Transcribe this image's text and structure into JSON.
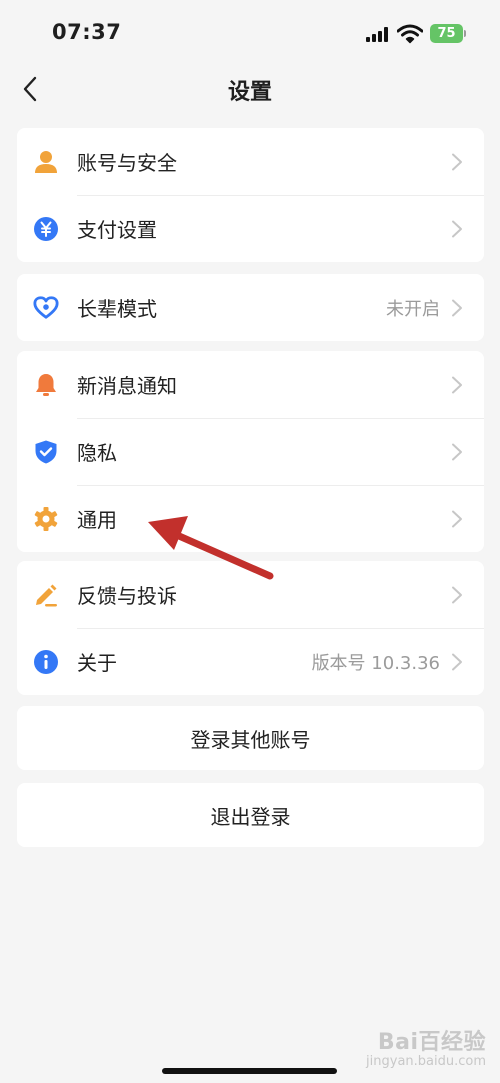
{
  "status_bar": {
    "time": "07:37",
    "battery": "75"
  },
  "nav": {
    "title": "设置"
  },
  "groups": [
    [
      {
        "label": "账号与安全",
        "icon": "person-icon",
        "color": "#f1a33a"
      },
      {
        "label": "支付设置",
        "icon": "yuan-icon",
        "color": "#3478f6"
      }
    ],
    [
      {
        "label": "长辈模式",
        "value": "未开启",
        "icon": "heart-icon",
        "color": "#3478f6"
      }
    ],
    [
      {
        "label": "新消息通知",
        "icon": "bell-icon",
        "color": "#f07a3c"
      },
      {
        "label": "隐私",
        "icon": "shield-icon",
        "color": "#3478f6"
      },
      {
        "label": "通用",
        "icon": "gear-icon",
        "color": "#f1a33a"
      }
    ],
    [
      {
        "label": "反馈与投诉",
        "icon": "pencil-icon",
        "color": "#f1a33a"
      },
      {
        "label": "关于",
        "value": "版本号 10.3.36",
        "icon": "info-icon",
        "color": "#3478f6"
      }
    ]
  ],
  "actions": {
    "switch_account": "登录其他账号",
    "logout": "退出登录"
  },
  "watermark": {
    "main": "Bai百经验",
    "sub": "jingyan.baidu.com"
  },
  "colors": {
    "background": "#f5f5f5",
    "annotation_arrow": "#c2302c"
  }
}
